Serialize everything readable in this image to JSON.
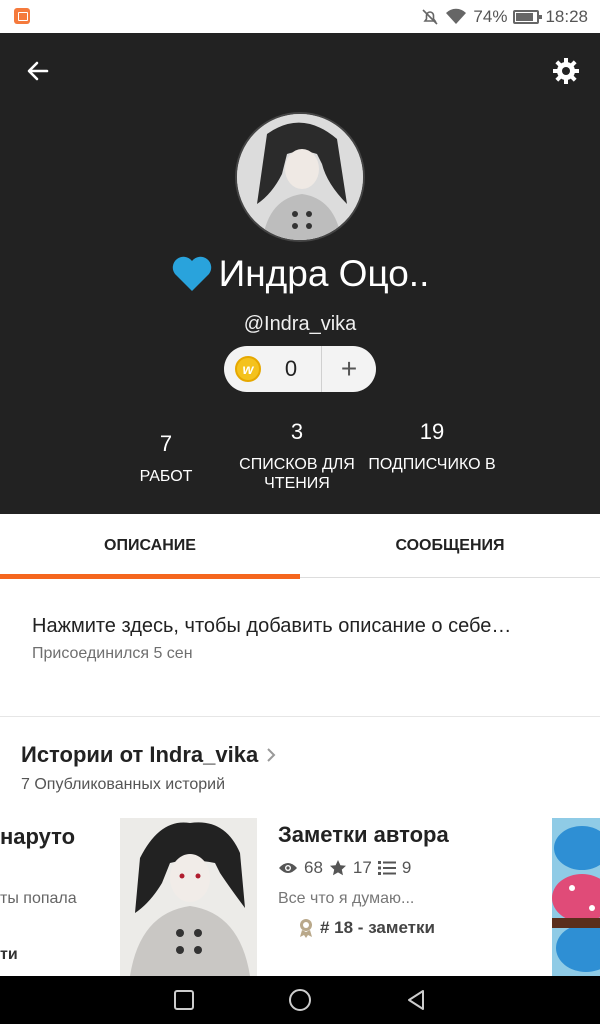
{
  "status_bar": {
    "battery": "74%",
    "time": "18:28"
  },
  "profile": {
    "display_name": "Индра Оцо..",
    "username": "@Indra_vika",
    "coins": "0",
    "add_symbol": "+",
    "coin_symbol": "w"
  },
  "stats": [
    {
      "value": "7",
      "label": "РАБОТ"
    },
    {
      "value": "3",
      "label": "СПИСКОВ ДЛЯ ЧТЕНИЯ"
    },
    {
      "value": "19",
      "label": "ПОДПИСЧИКО В"
    }
  ],
  "tabs": [
    {
      "label": "ОПИСАНИЕ",
      "active": true
    },
    {
      "label": "СООБЩЕНИЯ",
      "active": false
    }
  ],
  "about": {
    "prompt": "Нажмите здесь, чтобы добавить описание о себе…",
    "joined": "Присоединился 5 сен"
  },
  "stories_section": {
    "title": "Истории от Indra_vika",
    "subtitle": "7 Опубликованных историй"
  },
  "previous_story": {
    "title": "наруто",
    "desc": "ты попала",
    "tag": "ти"
  },
  "story": {
    "title": "Заметки автора",
    "reads": "68",
    "votes": "17",
    "parts": "9",
    "desc": "Все что я думаю...",
    "rank": "# 18 - заметки"
  },
  "colors": {
    "accent": "#f5661e",
    "header_bg": "#222222",
    "heart": "#29a3dc",
    "coin": "#f4c21d"
  }
}
